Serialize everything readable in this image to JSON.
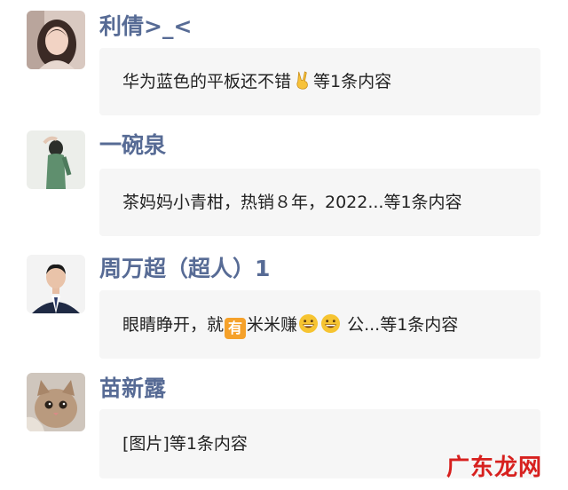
{
  "contacts": [
    {
      "name": "利倩>_<",
      "message": {
        "prefix": "华为蓝色的平板还不错",
        "emoji": "victory-hand",
        "suffix": "等1条内容"
      }
    },
    {
      "name": "一碗泉",
      "message": {
        "prefix": "茶妈妈小青柑，热销８年，2022...等1条内容"
      }
    },
    {
      "name": "周万超（超人）1",
      "message": {
        "prefix": "眼睛睁开，就",
        "badge": "有",
        "middle": "米米赚",
        "emoji": "grinning-face",
        "suffix": "公...等1条内容"
      }
    },
    {
      "name": "苗新露",
      "message": {
        "prefix": "[图片]等1条内容"
      }
    }
  ],
  "watermark": "广东龙网",
  "colors": {
    "name": "#576b95",
    "bubble": "#f6f6f6",
    "badge": "#f5a12a",
    "watermark": "#d7201e"
  }
}
